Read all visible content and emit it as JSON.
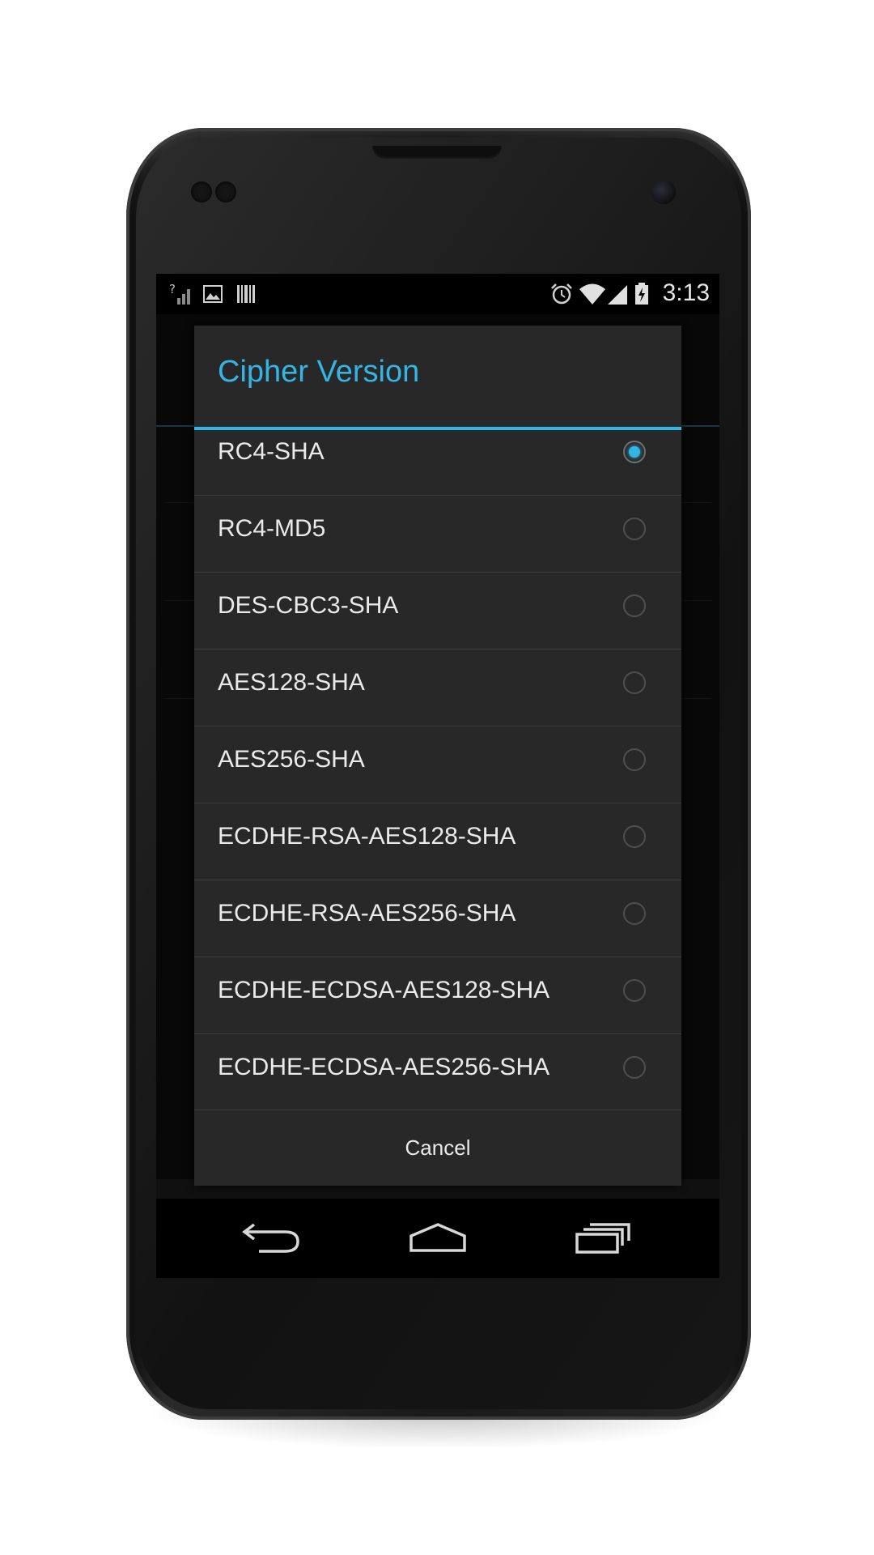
{
  "status_bar": {
    "time": "3:13",
    "left_icons": [
      "no-signal-icon",
      "image-notification-icon",
      "barcode-icon"
    ],
    "right_icons": [
      "alarm-icon",
      "wifi-icon",
      "signal-icon",
      "battery-charging-icon"
    ]
  },
  "dialog": {
    "title": "Cipher Version",
    "options": [
      {
        "label": "RC4-SHA",
        "selected": true
      },
      {
        "label": "RC4-MD5",
        "selected": false
      },
      {
        "label": "DES-CBC3-SHA",
        "selected": false
      },
      {
        "label": "AES128-SHA",
        "selected": false
      },
      {
        "label": "AES256-SHA",
        "selected": false
      },
      {
        "label": "ECDHE-RSA-AES128-SHA",
        "selected": false
      },
      {
        "label": "ECDHE-RSA-AES256-SHA",
        "selected": false
      },
      {
        "label": "ECDHE-ECDSA-AES128-SHA",
        "selected": false
      },
      {
        "label": "ECDHE-ECDSA-AES256-SHA",
        "selected": false
      }
    ],
    "cancel_label": "Cancel"
  },
  "nav_bar": {
    "icons": [
      "back-icon",
      "home-icon",
      "recent-apps-icon"
    ]
  },
  "colors": {
    "accent": "#33b5e5",
    "dialog_bg": "#282828",
    "text": "#eaeaea"
  }
}
